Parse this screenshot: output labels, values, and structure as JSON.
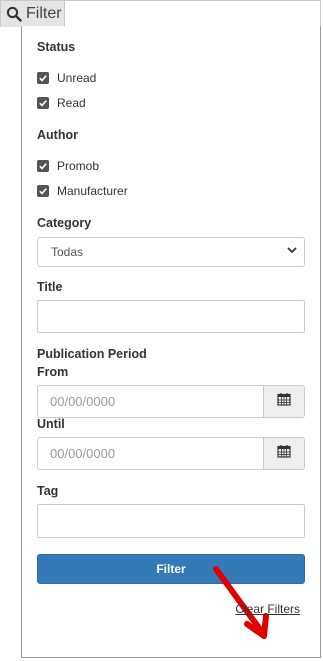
{
  "colors": {
    "primary": "#337ab7",
    "annotation_arrow": "#e00000",
    "checkbox": "#555555"
  },
  "toggle": {
    "icon": "search-icon",
    "label": "Filter"
  },
  "status": {
    "title": "Status",
    "options": [
      {
        "label": "Unread",
        "checked": true
      },
      {
        "label": "Read",
        "checked": true
      }
    ]
  },
  "author": {
    "title": "Author",
    "options": [
      {
        "label": "Promob",
        "checked": true
      },
      {
        "label": "Manufacturer",
        "checked": true
      }
    ]
  },
  "category": {
    "label": "Category",
    "selected": "Todas"
  },
  "title_field": {
    "label": "Title",
    "value": ""
  },
  "publication": {
    "label": "Publication Period",
    "from": {
      "label": "From",
      "placeholder": "00/00/0000",
      "icon": "calendar-icon"
    },
    "until": {
      "label": "Until",
      "placeholder": "00/00/0000",
      "icon": "calendar-icon"
    }
  },
  "tag_field": {
    "label": "Tag",
    "value": ""
  },
  "actions": {
    "filter_label": "Filter",
    "clear_label": "Clear Filters"
  }
}
